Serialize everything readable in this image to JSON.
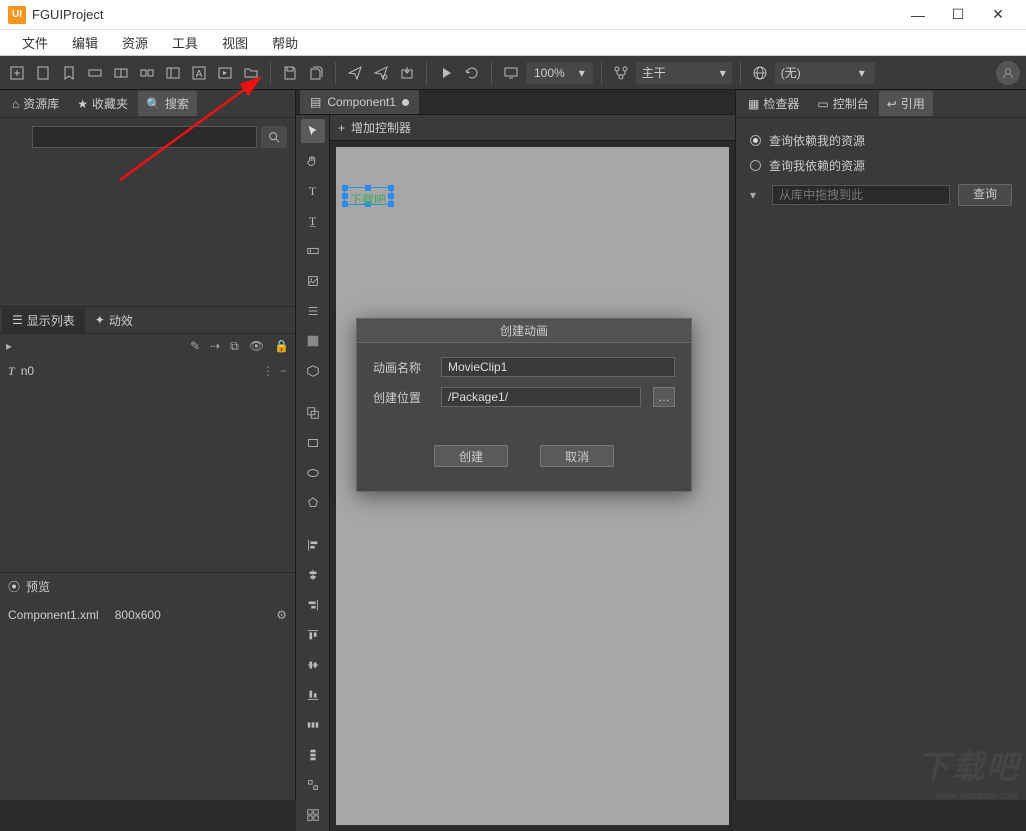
{
  "window": {
    "title": "FGUIProject",
    "logo": "UI"
  },
  "menubar": [
    "文件",
    "编辑",
    "资源",
    "工具",
    "视图",
    "帮助"
  ],
  "toolbar": {
    "zoom_value": "100%",
    "lane_value": "主干",
    "world_value": "(无)"
  },
  "left_panel": {
    "tabs": [
      {
        "icon": "home-icon",
        "label": "资源库"
      },
      {
        "icon": "star-icon",
        "label": "收藏夹"
      },
      {
        "icon": "search-icon",
        "label": "搜索"
      }
    ],
    "mid_tabs": [
      {
        "icon": "layers-icon",
        "label": "显示列表"
      },
      {
        "icon": "sparkle-icon",
        "label": "动效"
      }
    ],
    "list_item": {
      "icon": "T",
      "label": "n0",
      "trail1": "⋮",
      "trail2": "−"
    },
    "preview_label": "预览",
    "preview_file": "Component1.xml",
    "preview_size": "800x600"
  },
  "center": {
    "tab_label": "Component1",
    "ctrl_add": "增加控制器",
    "canvas_text": "下载吧"
  },
  "right_panel": {
    "tabs": [
      {
        "icon": "inspect-icon",
        "label": "检查器"
      },
      {
        "icon": "console-icon",
        "label": "控制台"
      },
      {
        "icon": "reference-icon",
        "label": "引用"
      }
    ],
    "radio1": "查询依赖我的资源",
    "radio2": "查询我依赖的资源",
    "input_placeholder": "从库中拖拽到此",
    "query_btn": "查询"
  },
  "dialog": {
    "title": "创建动画",
    "name_label": "动画名称",
    "name_value": "MovieClip1",
    "path_label": "创建位置",
    "path_value": "/Package1/",
    "create_btn": "创建",
    "cancel_btn": "取消"
  },
  "watermark": {
    "text": "下载吧",
    "url": "www.xiazaiba.com"
  }
}
